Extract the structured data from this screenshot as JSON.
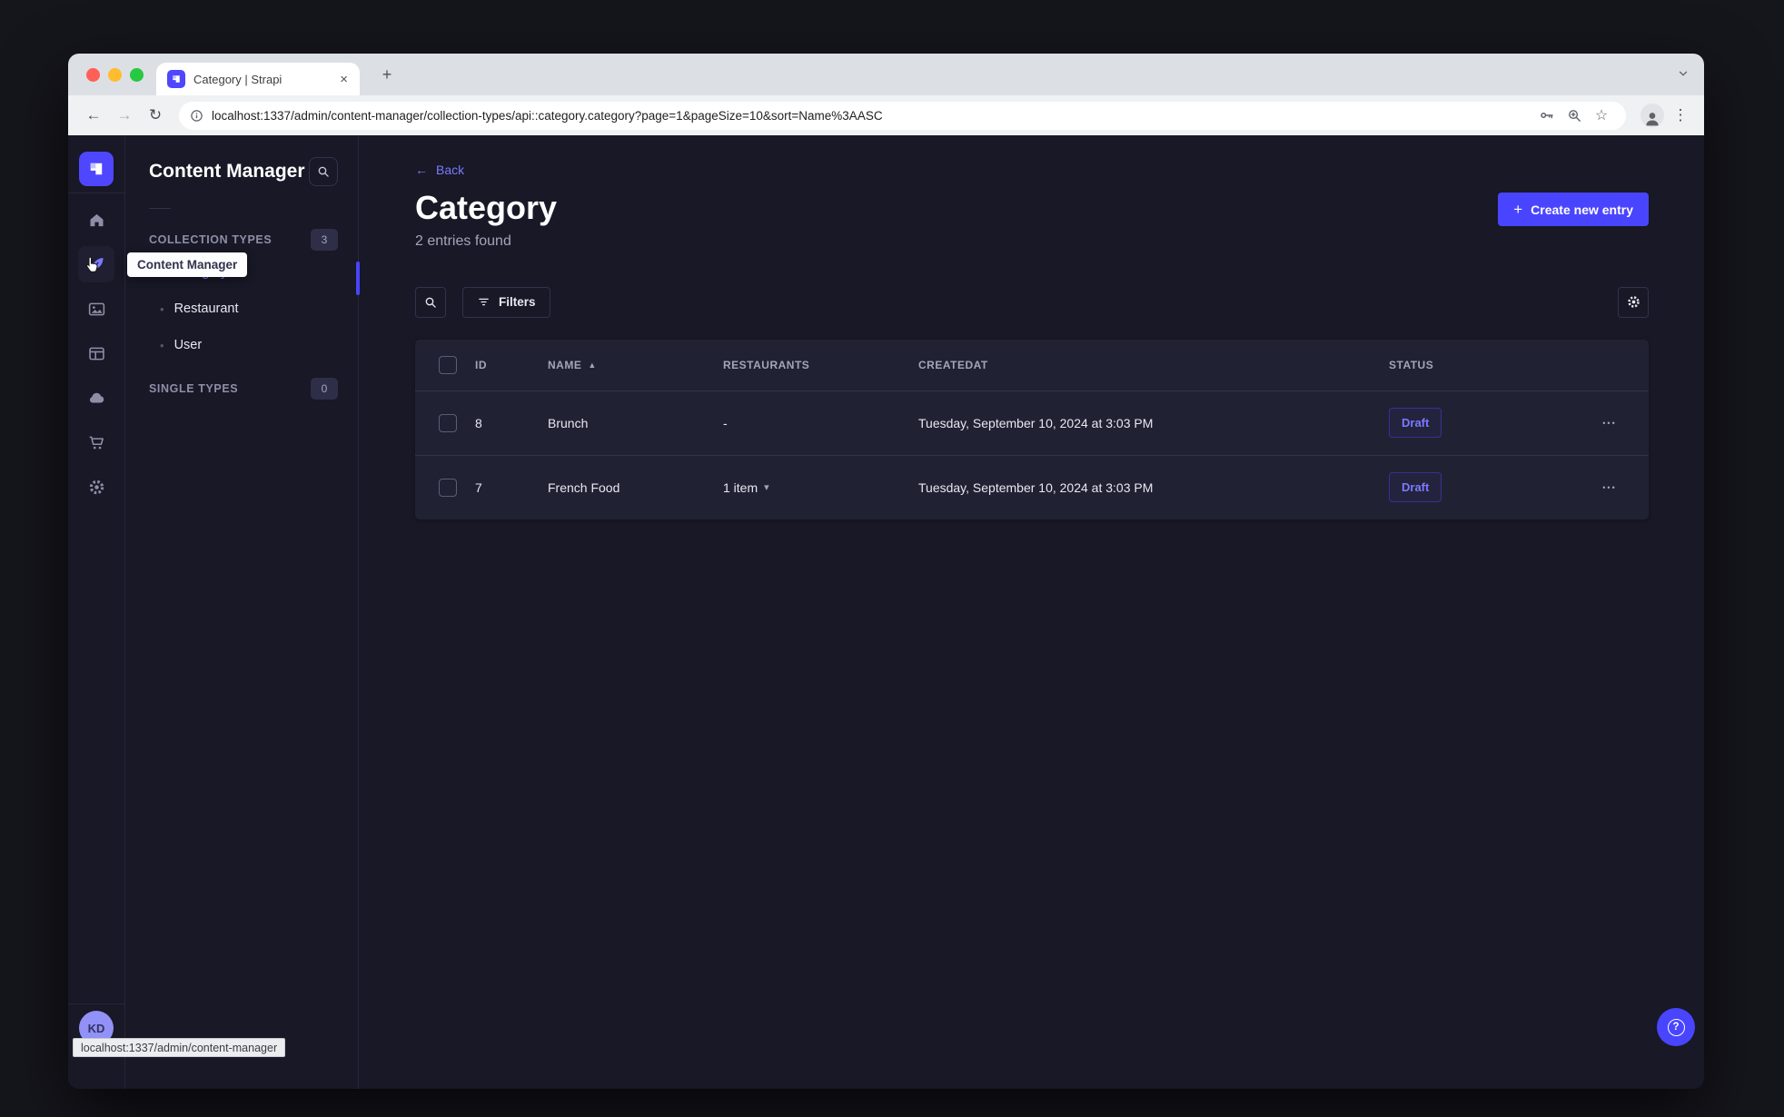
{
  "glyphs": {
    "back_arrow": "←",
    "forward_arrow": "→",
    "reload": "↻",
    "star": "☆",
    "overflow_menu": "⋮",
    "tab_close": "×",
    "new_tab": "+",
    "plus": "+",
    "bullet": "•",
    "caret_down": "▾",
    "sort_asc": "▲",
    "row_actions": "•••",
    "back_icon": "←",
    "help": "?"
  },
  "browser": {
    "tab_title": "Category | Strapi",
    "url": "localhost:1337/admin/content-manager/collection-types/api::category.category?page=1&pageSize=10&sort=Name%3AASC",
    "status_bar": "localhost:1337/admin/content-manager"
  },
  "sidebar": {
    "tooltip": "Content Manager",
    "avatar": "KD",
    "icons": [
      "home",
      "content-manager",
      "media-library",
      "content-type-builder",
      "deploy",
      "marketplace",
      "settings"
    ]
  },
  "panel": {
    "title": "Content Manager",
    "sections": {
      "collection_label": "COLLECTION TYPES",
      "collection_count": "3",
      "single_label": "SINGLE TYPES",
      "single_count": "0"
    },
    "items": [
      {
        "label": "Category"
      },
      {
        "label": "Restaurant"
      },
      {
        "label": "User"
      }
    ]
  },
  "main": {
    "back": "Back",
    "title": "Category",
    "subtitle": "2 entries found",
    "create_button": "Create new entry",
    "filters_button": "Filters",
    "table": {
      "headers": [
        "ID",
        "NAME",
        "RESTAURANTS",
        "CREATEDAT",
        "STATUS"
      ],
      "rows": [
        {
          "id": "8",
          "name": "Brunch",
          "restaurants": "-",
          "createdat": "Tuesday, September 10, 2024 at 3:03 PM",
          "status": "Draft"
        },
        {
          "id": "7",
          "name": "French Food",
          "restaurants": "1 item",
          "createdat": "Tuesday, September 10, 2024 at 3:03 PM",
          "status": "Draft"
        }
      ]
    }
  },
  "colors": {
    "primary": "#4945ff",
    "primary_light": "#7b79ff",
    "app_bg": "#181826",
    "surface": "#212134",
    "border": "#32324d",
    "muted": "#a5a5ba"
  }
}
